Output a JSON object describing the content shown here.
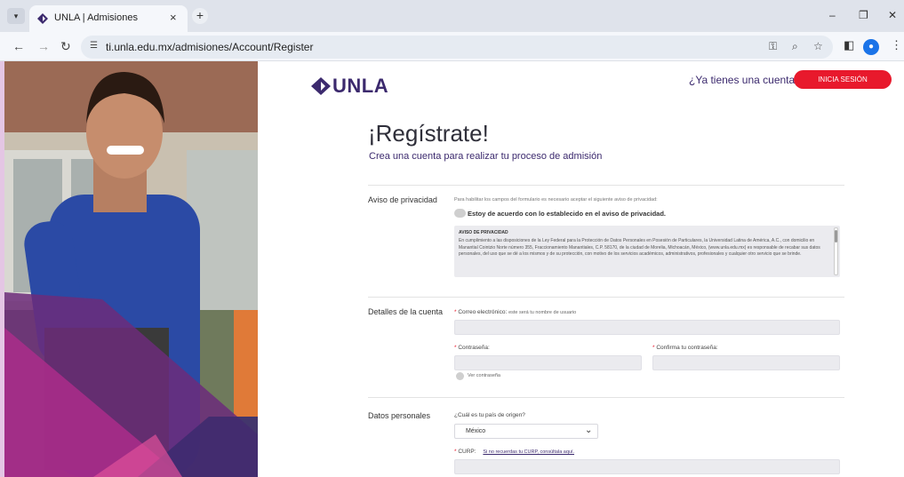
{
  "browser": {
    "tab_title": "UNLA | Admisiones",
    "tab_close": "×",
    "new_tab": "+",
    "url": "ti.unla.edu.mx/admisiones/Account/Register",
    "window_controls": {
      "minimize": "–",
      "restore": "❐",
      "close": "✕"
    }
  },
  "header": {
    "logo_text": "UNLA",
    "have_account": "¿Ya tienes una cuenta?",
    "login_button": "INICIA SESIÓN"
  },
  "main": {
    "title": "¡Regístrate!",
    "subtitle": "Crea una cuenta para realizar tu proceso de admisión"
  },
  "privacy_section": {
    "label": "Aviso de privacidad",
    "instruction": "Para habilitar los campos del formulario es necesario aceptar el siguiente aviso de privacidad:",
    "agree_label": "Estoy de acuerdo con lo establecido en el aviso de privacidad.",
    "notice_title": "AVISO DE PRIVACIDAD",
    "notice_text": "En cumplimiento a las disposiciones de la Ley Federal para la Protección de Datos Personales en Posesión de Particulares, la Universidad Latina de América, A.C., con domicilio en Manantial Cointzio Norte número 355, Fraccionamiento Manantiales, C.P. 58170, de la ciudad de Morelia, Michoacán, México, (www.unla.edu.mx) es responsable de recabar sus datos personales, del uso que se dé a los mismos y de su protección, con motivo de los servicios académicos, administrativos, profesionales y cualquier otro servicio que se brinde."
  },
  "account_section": {
    "label": "Detalles de la cuenta",
    "email_label": "Correo electrónico:",
    "email_help": "este será tu nombre de usuario",
    "email_value": "",
    "password_label": "Contraseña:",
    "password_value": "",
    "confirm_label": "Confirma tu contraseña:",
    "confirm_value": "",
    "show_password": "Ver contraseña",
    "required_mark": "*"
  },
  "personal_section": {
    "label": "Datos personales",
    "country_question": "¿Cuál es tu país de origen?",
    "country_selected": "México",
    "curp_label": "CURP:",
    "curp_link": "Si no recuerdas tu CURP, consúltala aquí.",
    "curp_value": ""
  },
  "colors": {
    "brand_purple": "#3c2a6e",
    "login_red": "#e8192c",
    "page_bg": "#e4c6e4"
  }
}
